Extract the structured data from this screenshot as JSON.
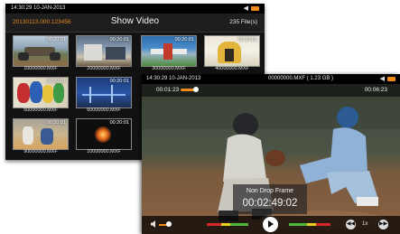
{
  "browser": {
    "status_time": "14:30:29  10-JAN-2013",
    "folder": "20130113.000.123456",
    "title": "Show Video",
    "file_count": "235 File(s)",
    "thumbnails": [
      {
        "timecode": "00:20:01",
        "filename": "10000000.MXF"
      },
      {
        "timecode": "00:20:01",
        "filename": "20000000.MXF"
      },
      {
        "timecode": "00:20:01",
        "filename": "30000000.MXF"
      },
      {
        "timecode": "00:20:01",
        "filename": "40000000.MXF"
      },
      {
        "timecode": "00:20:01",
        "filename": "50000000.MXF"
      },
      {
        "timecode": "00:20:01",
        "filename": "60000000.MXF"
      },
      {
        "timecode": "00:20:01",
        "filename": "90000000.MXF"
      },
      {
        "timecode": "00:20:01",
        "filename": "10000000.MXF"
      }
    ]
  },
  "player": {
    "status_time": "14:30:29  10-JAN-2013",
    "file_info": "00000000.MXF  ( 1.23 GB )",
    "current_time": "00:01:23",
    "duration": "00:06:23",
    "progress_fraction": 0.22,
    "timecode_label": "Non Drop Frame",
    "timecode_value": "00:02:49:02",
    "speed": "1x"
  },
  "colors": {
    "accent": "#f08a1a",
    "meter_red": "#d8262b",
    "meter_yellow": "#e6d220",
    "meter_green": "#4fb83a"
  },
  "icons": {
    "speaker": "speaker-icon",
    "battery": "battery-icon",
    "play": "play-icon",
    "rewind": "rewind-icon",
    "forward": "fast-forward-icon"
  }
}
